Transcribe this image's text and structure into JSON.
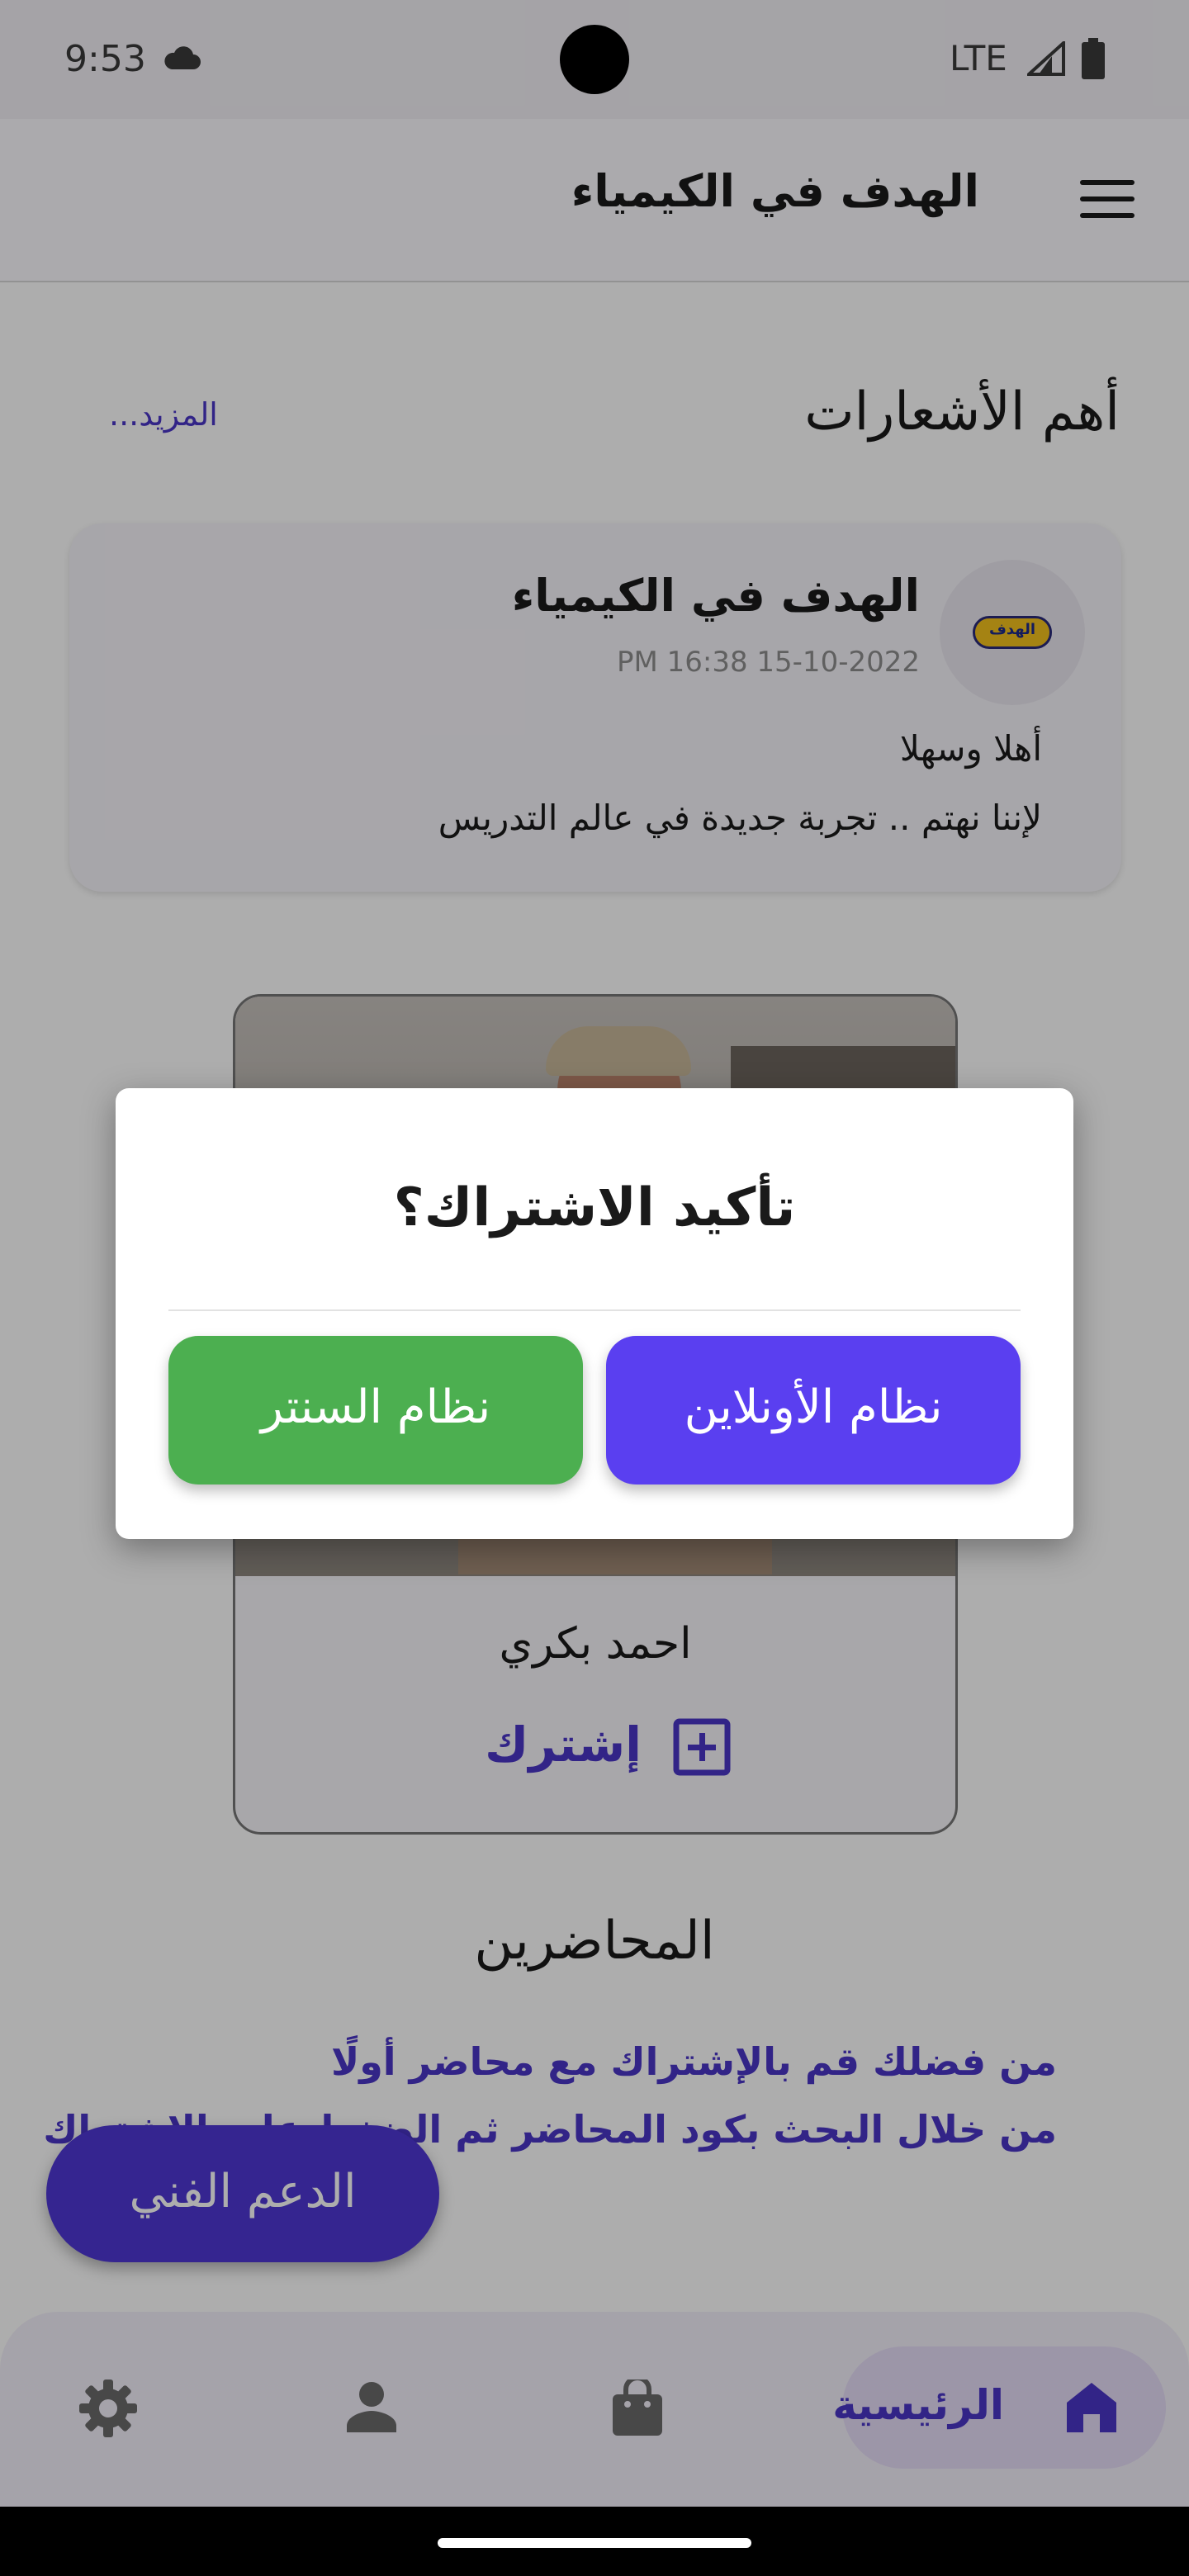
{
  "status_bar": {
    "time": "9:53",
    "network": "LTE"
  },
  "app_bar": {
    "title": "الهدف في الكيمياء"
  },
  "announcements": {
    "heading": "أهم الأشعارات",
    "more_link": "المزيد...",
    "card": {
      "title": "الهدف في الكيمياء",
      "date": "PM 16:38 15-10-2022",
      "line1": "أهلا وسهلا",
      "line2": "لإننا نهتم .. تجربة جديدة في عالم التدريس",
      "logo_text": "الهدف"
    }
  },
  "teacher_card": {
    "name": "احمد بكري",
    "subscribe_label": "إشترك"
  },
  "lecturers": {
    "heading": "المحاضرين",
    "instruction_line1": "من فضلك قم بالإشتراك مع محاضر أولًا",
    "instruction_line2": "من خلال البحث بكود المحاضر ثم الضغط على الاشتراك"
  },
  "support_fab": {
    "label": "الدعم الفني"
  },
  "bottom_nav": {
    "home_label": "الرئيسية",
    "items": [
      "home-icon",
      "bag-icon",
      "person-icon",
      "gear-icon"
    ]
  },
  "dialog": {
    "title": "تأكيد الاشتراك؟",
    "online_button": "نظام الأونلاين",
    "center_button": "نظام السنتر"
  },
  "colors": {
    "accent": "#4a35c8",
    "online_button": "#5a3ff0",
    "center_button": "#4caf50"
  }
}
